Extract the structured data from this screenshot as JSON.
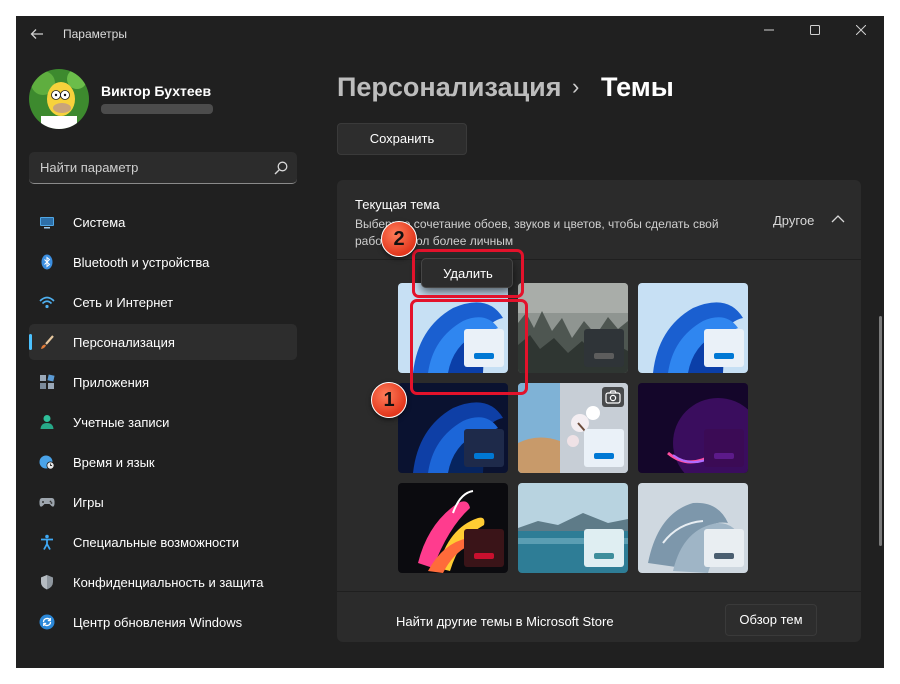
{
  "window": {
    "title": "Параметры"
  },
  "profile": {
    "name": "Виктор Бухтеев"
  },
  "search": {
    "placeholder": "Найти параметр"
  },
  "nav": {
    "items": [
      {
        "label": "Система",
        "icon": "monitor-icon",
        "active": false
      },
      {
        "label": "Bluetooth и устройства",
        "icon": "bluetooth-icon",
        "active": false
      },
      {
        "label": "Сеть и Интернет",
        "icon": "wifi-icon",
        "active": false
      },
      {
        "label": "Персонализация",
        "icon": "brush-icon",
        "active": true
      },
      {
        "label": "Приложения",
        "icon": "apps-icon",
        "active": false
      },
      {
        "label": "Учетные записи",
        "icon": "person-icon",
        "active": false
      },
      {
        "label": "Время и язык",
        "icon": "clock-globe-icon",
        "active": false
      },
      {
        "label": "Игры",
        "icon": "gamepad-icon",
        "active": false
      },
      {
        "label": "Специальные возможности",
        "icon": "accessibility-icon",
        "active": false
      },
      {
        "label": "Конфиденциальность и защита",
        "icon": "shield-icon",
        "active": false
      },
      {
        "label": "Центр обновления Windows",
        "icon": "update-icon",
        "active": false
      }
    ]
  },
  "breadcrumb": {
    "parent": "Персонализация",
    "separator": "›",
    "current": "Темы"
  },
  "toolbar": {
    "save_label": "Сохранить"
  },
  "theme_card": {
    "title": "Текущая тема",
    "description": "Выберите сочетание обоев, звуков и цветов, чтобы сделать свой рабочий стол более личным",
    "value": "Другое"
  },
  "context_menu": {
    "delete_label": "Удалить"
  },
  "themes": [
    {
      "name": "windows-light-bloom",
      "accent": "#0078d4"
    },
    {
      "name": "misty-forest",
      "accent": "#5d5d5d"
    },
    {
      "name": "windows-light",
      "accent": "#0078d4"
    },
    {
      "name": "windows-dark",
      "accent": "#0078d4"
    },
    {
      "name": "spotlight-flowers",
      "accent": "#0078d4"
    },
    {
      "name": "glow",
      "accent": "#5c1a8a"
    },
    {
      "name": "captured-motion",
      "accent": "#c8102e"
    },
    {
      "name": "sunrise-lake",
      "accent": "#3e8e9c"
    },
    {
      "name": "flow",
      "accent": "#4a5e70"
    }
  ],
  "store": {
    "text": "Найти другие темы в Microsoft Store",
    "button_label": "Обзор тем"
  },
  "annotations": {
    "step1": "1",
    "step2": "2",
    "highlight_color": "#e3122b"
  }
}
